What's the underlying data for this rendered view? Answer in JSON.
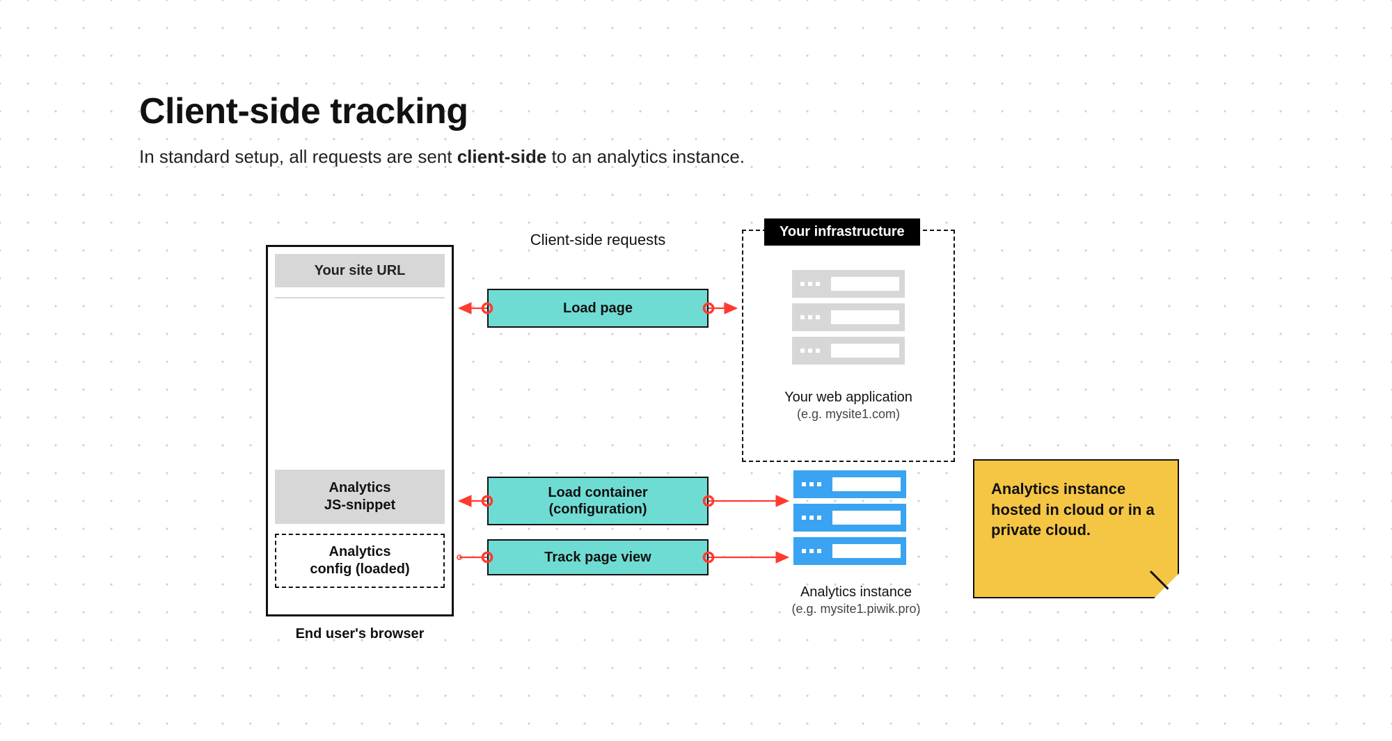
{
  "heading": {
    "title": "Client-side tracking",
    "subtitle_pre": "In standard setup, all requests are sent ",
    "subtitle_bold": "client-side",
    "subtitle_post": " to an analytics instance."
  },
  "browser": {
    "url_label": "Your site URL",
    "snippet_line1": "Analytics",
    "snippet_line2": "JS-snippet",
    "config_line1": "Analytics",
    "config_line2": "config (loaded)",
    "caption": "End user's browser"
  },
  "requests": {
    "section_label": "Client-side requests",
    "load_page": "Load page",
    "load_container_line1": "Load container",
    "load_container_line2": "(configuration)",
    "track_page_view": "Track page view"
  },
  "infra": {
    "tab": "Your infrastructure",
    "caption_line1": "Your web application",
    "caption_line2": "(e.g. mysite1.com)"
  },
  "analytics": {
    "caption_line1": "Analytics instance",
    "caption_line2": "(e.g. mysite1.piwik.pro)"
  },
  "note": {
    "text": "Analytics instance hosted in cloud or in a private cloud."
  },
  "colors": {
    "teal": "#6fdcd4",
    "blue": "#3aa3f2",
    "yellow": "#f5c544",
    "red": "#ff3b30",
    "gray": "#d7d7d7"
  }
}
